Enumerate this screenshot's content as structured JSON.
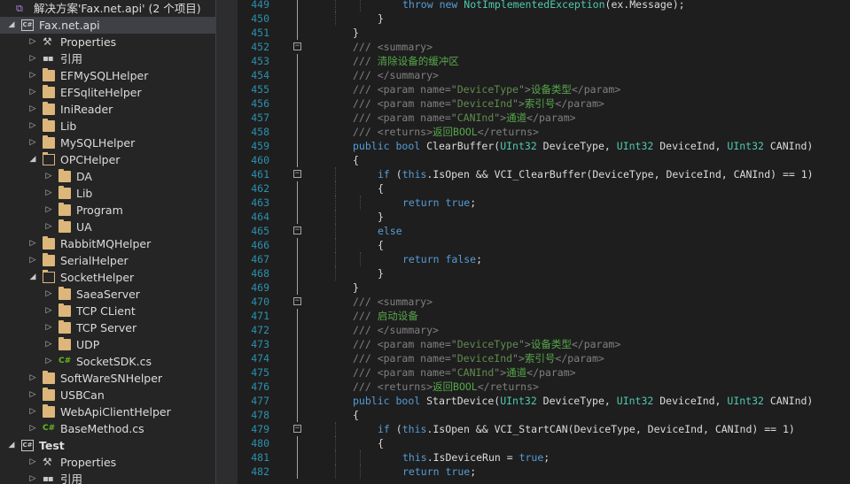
{
  "solution_explorer": {
    "items": [
      {
        "label": "解决方案'Fax.net.api' (2 个项目)",
        "icon": "solution-icon",
        "depth": 0,
        "arrow": "",
        "type": "solution"
      },
      {
        "label": "Fax.net.api",
        "icon": "csharp-project-icon",
        "depth": 0,
        "arrow": "open",
        "type": "project",
        "selected": true
      },
      {
        "label": "Properties",
        "icon": "wrench-icon",
        "depth": 1,
        "arrow": "closed",
        "type": "properties"
      },
      {
        "label": "引用",
        "icon": "references-icon",
        "depth": 1,
        "arrow": "closed",
        "type": "references"
      },
      {
        "label": "EFMySQLHelper",
        "icon": "folder-icon",
        "depth": 1,
        "arrow": "closed",
        "type": "folder"
      },
      {
        "label": "EFSqliteHelper",
        "icon": "folder-icon",
        "depth": 1,
        "arrow": "closed",
        "type": "folder"
      },
      {
        "label": "IniReader",
        "icon": "folder-icon",
        "depth": 1,
        "arrow": "closed",
        "type": "folder"
      },
      {
        "label": "Lib",
        "icon": "folder-icon",
        "depth": 1,
        "arrow": "closed",
        "type": "folder"
      },
      {
        "label": "MySQLHelper",
        "icon": "folder-icon",
        "depth": 1,
        "arrow": "closed",
        "type": "folder"
      },
      {
        "label": "OPCHelper",
        "icon": "folder-open-icon",
        "depth": 1,
        "arrow": "open",
        "type": "folder-open"
      },
      {
        "label": "DA",
        "icon": "folder-icon",
        "depth": 2,
        "arrow": "closed",
        "type": "folder"
      },
      {
        "label": "Lib",
        "icon": "folder-icon",
        "depth": 2,
        "arrow": "closed",
        "type": "folder"
      },
      {
        "label": "Program",
        "icon": "folder-icon",
        "depth": 2,
        "arrow": "closed",
        "type": "folder"
      },
      {
        "label": "UA",
        "icon": "folder-icon",
        "depth": 2,
        "arrow": "closed",
        "type": "folder"
      },
      {
        "label": "RabbitMQHelper",
        "icon": "folder-icon",
        "depth": 1,
        "arrow": "closed",
        "type": "folder"
      },
      {
        "label": "SerialHelper",
        "icon": "folder-icon",
        "depth": 1,
        "arrow": "closed",
        "type": "folder"
      },
      {
        "label": "SocketHelper",
        "icon": "folder-open-icon",
        "depth": 1,
        "arrow": "open",
        "type": "folder-open"
      },
      {
        "label": "SaeaServer",
        "icon": "folder-icon",
        "depth": 2,
        "arrow": "closed",
        "type": "folder"
      },
      {
        "label": "TCP CLient",
        "icon": "folder-icon",
        "depth": 2,
        "arrow": "closed",
        "type": "folder"
      },
      {
        "label": "TCP Server",
        "icon": "folder-icon",
        "depth": 2,
        "arrow": "closed",
        "type": "folder"
      },
      {
        "label": "UDP",
        "icon": "folder-icon",
        "depth": 2,
        "arrow": "closed",
        "type": "folder"
      },
      {
        "label": "SocketSDK.cs",
        "icon": "csharp-file-icon",
        "depth": 2,
        "arrow": "closed",
        "type": "csfile"
      },
      {
        "label": "SoftWareSNHelper",
        "icon": "folder-icon",
        "depth": 1,
        "arrow": "closed",
        "type": "folder"
      },
      {
        "label": "USBCan",
        "icon": "folder-icon",
        "depth": 1,
        "arrow": "closed",
        "type": "folder"
      },
      {
        "label": "WebApiClientHelper",
        "icon": "folder-icon",
        "depth": 1,
        "arrow": "closed",
        "type": "folder"
      },
      {
        "label": "BaseMethod.cs",
        "icon": "csharp-file-icon",
        "depth": 1,
        "arrow": "closed",
        "type": "csfile"
      },
      {
        "label": "Test",
        "icon": "csharp-project-icon",
        "depth": 0,
        "arrow": "open",
        "type": "project",
        "bold": true
      },
      {
        "label": "Properties",
        "icon": "wrench-icon",
        "depth": 1,
        "arrow": "closed",
        "type": "properties"
      },
      {
        "label": "引用",
        "icon": "references-icon",
        "depth": 1,
        "arrow": "closed",
        "type": "references"
      }
    ]
  },
  "editor": {
    "lines": [
      {
        "num": "449",
        "indent": 3,
        "tokens": [
          [
            "k",
            "throw"
          ],
          [
            "p",
            " "
          ],
          [
            "k",
            "new"
          ],
          [
            "p",
            " "
          ],
          [
            "t",
            "NotImplementedException"
          ],
          [
            "p",
            "(ex.Message);"
          ]
        ]
      },
      {
        "num": "450",
        "indent": 2,
        "tokens": [
          [
            "p",
            "}"
          ]
        ]
      },
      {
        "num": "451",
        "indent": 1,
        "tokens": [
          [
            "p",
            "}"
          ]
        ]
      },
      {
        "num": "452",
        "indent": 1,
        "fold": "-",
        "tokens": [
          [
            "g",
            "/// "
          ],
          [
            "g",
            "<summary>"
          ]
        ]
      },
      {
        "num": "453",
        "indent": 1,
        "tokens": [
          [
            "g",
            "/// "
          ],
          [
            "c",
            "清除设备的缓冲区"
          ]
        ]
      },
      {
        "num": "454",
        "indent": 1,
        "tokens": [
          [
            "g",
            "/// "
          ],
          [
            "g",
            "</summary>"
          ]
        ]
      },
      {
        "num": "455",
        "indent": 1,
        "tokens": [
          [
            "g",
            "/// "
          ],
          [
            "g",
            "<param name="
          ],
          [
            "g",
            "\""
          ],
          [
            "cm",
            "DeviceType"
          ],
          [
            "g",
            "\""
          ],
          [
            "g",
            ">"
          ],
          [
            "c",
            "设备类型"
          ],
          [
            "g",
            "</param>"
          ]
        ]
      },
      {
        "num": "456",
        "indent": 1,
        "tokens": [
          [
            "g",
            "/// "
          ],
          [
            "g",
            "<param name="
          ],
          [
            "g",
            "\""
          ],
          [
            "cm",
            "DeviceInd"
          ],
          [
            "g",
            "\""
          ],
          [
            "g",
            ">"
          ],
          [
            "c",
            "索引号"
          ],
          [
            "g",
            "</param>"
          ]
        ]
      },
      {
        "num": "457",
        "indent": 1,
        "tokens": [
          [
            "g",
            "/// "
          ],
          [
            "g",
            "<param name="
          ],
          [
            "g",
            "\""
          ],
          [
            "cm",
            "CANInd"
          ],
          [
            "g",
            "\""
          ],
          [
            "g",
            ">"
          ],
          [
            "c",
            "通道"
          ],
          [
            "g",
            "</param>"
          ]
        ]
      },
      {
        "num": "458",
        "indent": 1,
        "tokens": [
          [
            "g",
            "/// "
          ],
          [
            "g",
            "<returns>"
          ],
          [
            "c",
            "返回BOOL"
          ],
          [
            "g",
            "</returns>"
          ]
        ]
      },
      {
        "num": "459",
        "indent": 1,
        "tokens": [
          [
            "k",
            "public"
          ],
          [
            "p",
            " "
          ],
          [
            "k",
            "bool"
          ],
          [
            "p",
            " ClearBuffer("
          ],
          [
            "t",
            "UInt32"
          ],
          [
            "p",
            " DeviceType, "
          ],
          [
            "t",
            "UInt32"
          ],
          [
            "p",
            " DeviceInd, "
          ],
          [
            "t",
            "UInt32"
          ],
          [
            "p",
            " CANInd)"
          ]
        ]
      },
      {
        "num": "460",
        "indent": 1,
        "tokens": [
          [
            "p",
            "{"
          ]
        ]
      },
      {
        "num": "461",
        "indent": 2,
        "fold": "-",
        "tokens": [
          [
            "k",
            "if"
          ],
          [
            "p",
            " ("
          ],
          [
            "k",
            "this"
          ],
          [
            "p",
            ".IsOpen && VCI_ClearBuffer(DeviceType, DeviceInd, CANInd) == 1)"
          ]
        ]
      },
      {
        "num": "462",
        "indent": 2,
        "tokens": [
          [
            "p",
            "{"
          ]
        ]
      },
      {
        "num": "463",
        "indent": 3,
        "tokens": [
          [
            "k",
            "return"
          ],
          [
            "p",
            " "
          ],
          [
            "k",
            "true"
          ],
          [
            "p",
            ";"
          ]
        ]
      },
      {
        "num": "464",
        "indent": 2,
        "tokens": [
          [
            "p",
            "}"
          ]
        ]
      },
      {
        "num": "465",
        "indent": 2,
        "fold": "-",
        "tokens": [
          [
            "k",
            "else"
          ]
        ]
      },
      {
        "num": "466",
        "indent": 2,
        "tokens": [
          [
            "p",
            "{"
          ]
        ]
      },
      {
        "num": "467",
        "indent": 3,
        "tokens": [
          [
            "k",
            "return"
          ],
          [
            "p",
            " "
          ],
          [
            "k",
            "false"
          ],
          [
            "p",
            ";"
          ]
        ]
      },
      {
        "num": "468",
        "indent": 2,
        "tokens": [
          [
            "p",
            "}"
          ]
        ]
      },
      {
        "num": "469",
        "indent": 1,
        "tokens": [
          [
            "p",
            "}"
          ]
        ]
      },
      {
        "num": "470",
        "indent": 1,
        "fold": "-",
        "tokens": [
          [
            "g",
            "/// "
          ],
          [
            "g",
            "<summary>"
          ]
        ]
      },
      {
        "num": "471",
        "indent": 1,
        "tokens": [
          [
            "g",
            "/// "
          ],
          [
            "c",
            "启动设备"
          ]
        ]
      },
      {
        "num": "472",
        "indent": 1,
        "tokens": [
          [
            "g",
            "/// "
          ],
          [
            "g",
            "</summary>"
          ]
        ]
      },
      {
        "num": "473",
        "indent": 1,
        "tokens": [
          [
            "g",
            "/// "
          ],
          [
            "g",
            "<param name="
          ],
          [
            "g",
            "\""
          ],
          [
            "cm",
            "DeviceType"
          ],
          [
            "g",
            "\""
          ],
          [
            "g",
            ">"
          ],
          [
            "c",
            "设备类型"
          ],
          [
            "g",
            "</param>"
          ]
        ]
      },
      {
        "num": "474",
        "indent": 1,
        "tokens": [
          [
            "g",
            "/// "
          ],
          [
            "g",
            "<param name="
          ],
          [
            "g",
            "\""
          ],
          [
            "cm",
            "DeviceInd"
          ],
          [
            "g",
            "\""
          ],
          [
            "g",
            ">"
          ],
          [
            "c",
            "索引号"
          ],
          [
            "g",
            "</param>"
          ]
        ]
      },
      {
        "num": "475",
        "indent": 1,
        "tokens": [
          [
            "g",
            "/// "
          ],
          [
            "g",
            "<param name="
          ],
          [
            "g",
            "\""
          ],
          [
            "cm",
            "CANInd"
          ],
          [
            "g",
            "\""
          ],
          [
            "g",
            ">"
          ],
          [
            "c",
            "通道"
          ],
          [
            "g",
            "</param>"
          ]
        ]
      },
      {
        "num": "476",
        "indent": 1,
        "tokens": [
          [
            "g",
            "/// "
          ],
          [
            "g",
            "<returns>"
          ],
          [
            "c",
            "返回BOOL"
          ],
          [
            "g",
            "</returns>"
          ]
        ]
      },
      {
        "num": "477",
        "indent": 1,
        "tokens": [
          [
            "k",
            "public"
          ],
          [
            "p",
            " "
          ],
          [
            "k",
            "bool"
          ],
          [
            "p",
            " StartDevice("
          ],
          [
            "t",
            "UInt32"
          ],
          [
            "p",
            " DeviceType, "
          ],
          [
            "t",
            "UInt32"
          ],
          [
            "p",
            " DeviceInd, "
          ],
          [
            "t",
            "UInt32"
          ],
          [
            "p",
            " CANInd)"
          ]
        ]
      },
      {
        "num": "478",
        "indent": 1,
        "tokens": [
          [
            "p",
            "{"
          ]
        ]
      },
      {
        "num": "479",
        "indent": 2,
        "fold": "-",
        "tokens": [
          [
            "k",
            "if"
          ],
          [
            "p",
            " ("
          ],
          [
            "k",
            "this"
          ],
          [
            "p",
            ".IsOpen && VCI_StartCAN(DeviceType, DeviceInd, CANInd) == 1)"
          ]
        ]
      },
      {
        "num": "480",
        "indent": 2,
        "tokens": [
          [
            "p",
            "{"
          ]
        ]
      },
      {
        "num": "481",
        "indent": 3,
        "tokens": [
          [
            "k",
            "this"
          ],
          [
            "p",
            ".IsDeviceRun = "
          ],
          [
            "k",
            "true"
          ],
          [
            "p",
            ";"
          ]
        ]
      },
      {
        "num": "482",
        "indent": 3,
        "tokens": [
          [
            "k",
            "return"
          ],
          [
            "p",
            " "
          ],
          [
            "k",
            "true"
          ],
          [
            "p",
            ";"
          ]
        ]
      }
    ]
  }
}
